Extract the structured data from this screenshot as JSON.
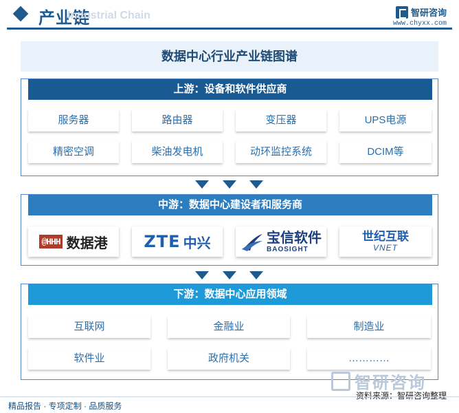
{
  "header": {
    "title": "产业链",
    "watermark": "Industrial Chain",
    "brand_name": "智研咨询",
    "brand_url": "www.chyxx.com"
  },
  "main_title": "数据中心行业产业链图谱",
  "upstream": {
    "title": "上游：设备和软件供应商",
    "items": [
      "服务器",
      "路由器",
      "变压器",
      "UPS电源",
      "精密空调",
      "柴油发电机",
      "动环监控系统",
      "DCIM等"
    ]
  },
  "midstream": {
    "title": "中游：数据中心建设者和服务商",
    "logos": [
      {
        "mark": "@HHH",
        "name": "数据港"
      },
      {
        "en": "ZTE",
        "cn": "中兴"
      },
      {
        "cn": "宝信软件",
        "en": "BAOSIGHT"
      },
      {
        "cn": "世纪互联",
        "en": "VNET"
      }
    ]
  },
  "downstream": {
    "title": "下游：数据中心应用领域",
    "items": [
      "互联网",
      "金融业",
      "制造业",
      "软件业",
      "政府机关",
      "…………"
    ]
  },
  "footer": {
    "watermark": "智研咨询",
    "left": "精品报告 · 专项定制 · 品质服务",
    "source": "资料来源：智研咨询整理"
  },
  "colors": {
    "dark_blue": "#1e5a8e",
    "upstream_head": "#1a5a92",
    "midstream_head": "#2d7ec1",
    "downstream_head": "#1f9ad8"
  }
}
